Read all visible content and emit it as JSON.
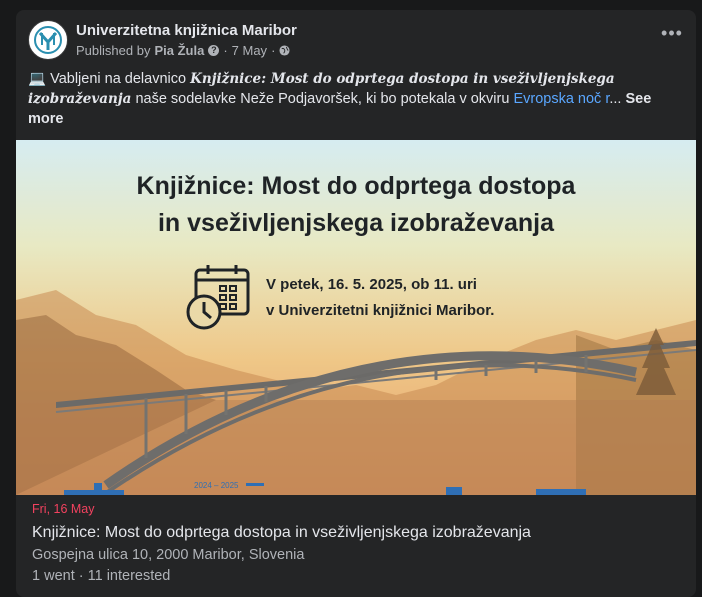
{
  "post": {
    "page_name": "Univerzitetna knjižnica Maribor",
    "published_by_label": "Published by",
    "author": "Pia Žula",
    "date": "7 May",
    "text_emoji": "💻",
    "text_before": "Vabljeni na delavnico",
    "text_italic": "Knjižnice: Most do odprtega dostopa in vseživljenjskega izobraževanja",
    "text_middle": "naše sodelavke Neže Podjavoršek, ki bo potekala v okviru",
    "text_link": "Evropska noč r",
    "text_ellipsis": "...",
    "see_more": "See more"
  },
  "banner": {
    "title_line1": "Knjižnice: Most do odprtega dostopa",
    "title_line2": "in vseživljenjskega izobraževanja",
    "date_line1": "V petek, 16. 5. 2025, ob 11. uri",
    "date_line2": "v Univerzitetni knjižnici Maribor.",
    "strip_text": "2024 – 2025"
  },
  "event": {
    "date": "Fri, 16 May",
    "title": "Knjižnice: Most do odprtega dostopa in vseživljenjskega izobraževanja",
    "location": "Gospejna ulica 10, 2000 Maribor, Slovenia",
    "stats": "1 went · 11 interested"
  },
  "icons": {
    "avatar": "library-logo-icon",
    "info": "info-icon",
    "audience": "globe-icon",
    "more": "more-options-icon",
    "calendar": "calendar-clock-icon"
  },
  "colors": {
    "card_bg": "#242526",
    "link": "#5aa7ff",
    "event_date": "#f3425f",
    "banner_text": "#1f2326"
  }
}
